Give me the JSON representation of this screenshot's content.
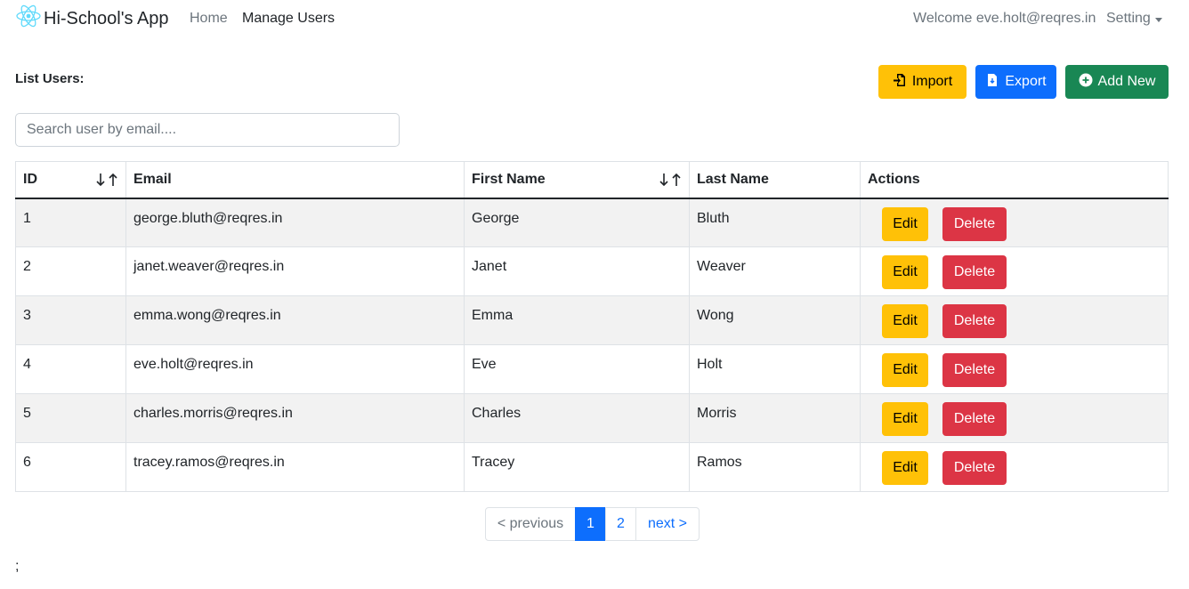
{
  "navbar": {
    "brand": "Hi-School's App",
    "home": "Home",
    "manage_users": "Manage Users",
    "welcome": "Welcome eve.holt@reqres.in",
    "setting": "Setting"
  },
  "header": {
    "title": "List Users:",
    "import_label": "Import",
    "export_label": "Export",
    "add_label": "Add New"
  },
  "search": {
    "placeholder": "Search user by email...."
  },
  "table": {
    "columns": [
      "ID",
      "Email",
      "First Name",
      "Last Name",
      "Actions"
    ],
    "rows": [
      {
        "id": "1",
        "email": "george.bluth@reqres.in",
        "first": "George",
        "last": "Bluth"
      },
      {
        "id": "2",
        "email": "janet.weaver@reqres.in",
        "first": "Janet",
        "last": "Weaver"
      },
      {
        "id": "3",
        "email": "emma.wong@reqres.in",
        "first": "Emma",
        "last": "Wong"
      },
      {
        "id": "4",
        "email": "eve.holt@reqres.in",
        "first": "Eve",
        "last": "Holt"
      },
      {
        "id": "5",
        "email": "charles.morris@reqres.in",
        "first": "Charles",
        "last": "Morris"
      },
      {
        "id": "6",
        "email": "tracey.ramos@reqres.in",
        "first": "Tracey",
        "last": "Ramos"
      }
    ],
    "edit_label": "Edit",
    "delete_label": "Delete"
  },
  "pagination": {
    "previous": "< previous",
    "pages": [
      "1",
      "2"
    ],
    "next": "next >",
    "active_page": "1"
  },
  "footer_text": ";",
  "colors": {
    "warning": "#ffc107",
    "primary": "#0d6efd",
    "success": "#198754",
    "danger": "#dc3545",
    "react_logo": "#61dafb"
  }
}
